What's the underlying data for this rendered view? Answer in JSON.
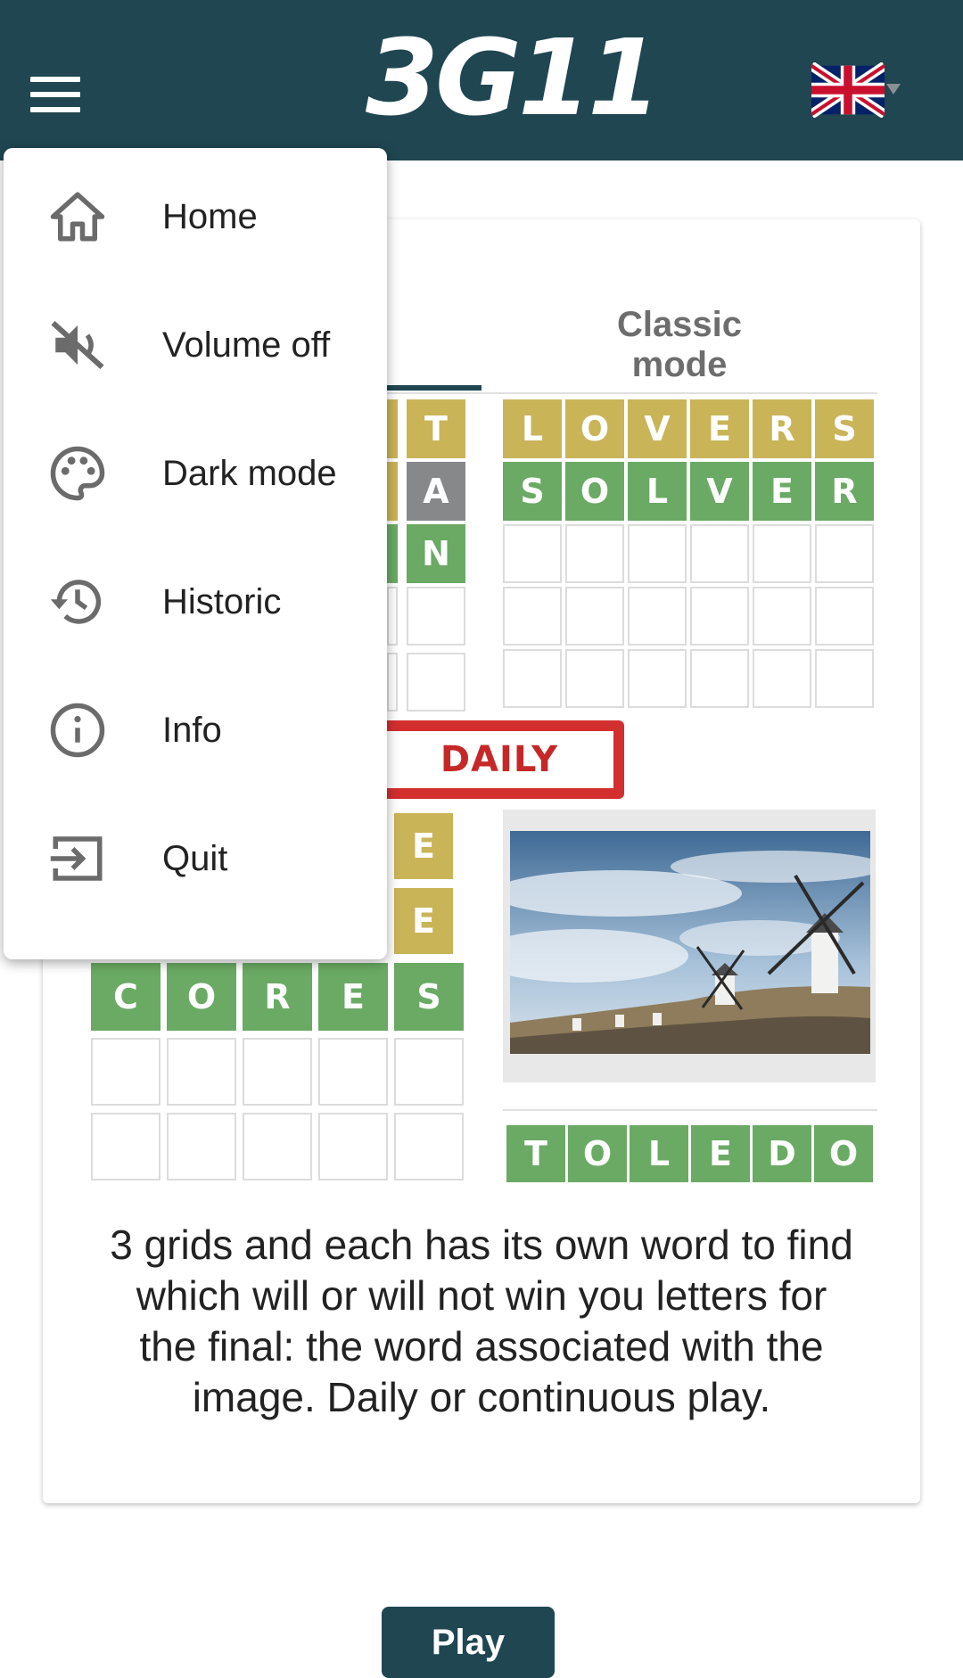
{
  "header": {
    "logo_text": "3G11",
    "menu_icon": "hamburger-menu-icon",
    "language_flag": "uk-flag-icon"
  },
  "menu": {
    "items": [
      {
        "label": "Home",
        "icon": "home-icon"
      },
      {
        "label": "Volume off",
        "icon": "volume-off-icon"
      },
      {
        "label": "Dark mode",
        "icon": "palette-icon"
      },
      {
        "label": "Historic",
        "icon": "history-icon"
      },
      {
        "label": "Info",
        "icon": "info-icon"
      },
      {
        "label": "Quit",
        "icon": "exit-icon"
      }
    ]
  },
  "card": {
    "tab_classic": "Classic mode",
    "daily_badge": "DAILY",
    "left_top_grid_visible": [
      "T",
      "A",
      "N"
    ],
    "right_grid": {
      "row1": [
        "L",
        "O",
        "V",
        "E",
        "R",
        "S"
      ],
      "row2": [
        "S",
        "O",
        "L",
        "V",
        "E",
        "R"
      ]
    },
    "left_bottom_grid": {
      "row1_visible": [
        "E"
      ],
      "row2_visible": [
        "E"
      ],
      "row3": [
        "C",
        "O",
        "R",
        "E",
        "S"
      ]
    },
    "final_word": [
      "T",
      "O",
      "L",
      "E",
      "D",
      "O"
    ],
    "description": "3 grids and each has its own word to find which will or will not win you letters for the final: the word associated with the image. Daily or continuous play.",
    "play_button": "Play"
  },
  "colors": {
    "header_bg": "#1f4651",
    "yellow": "#c9b458",
    "green": "#6aaa64",
    "gray": "#86888a",
    "daily_red": "#d32f2f"
  }
}
